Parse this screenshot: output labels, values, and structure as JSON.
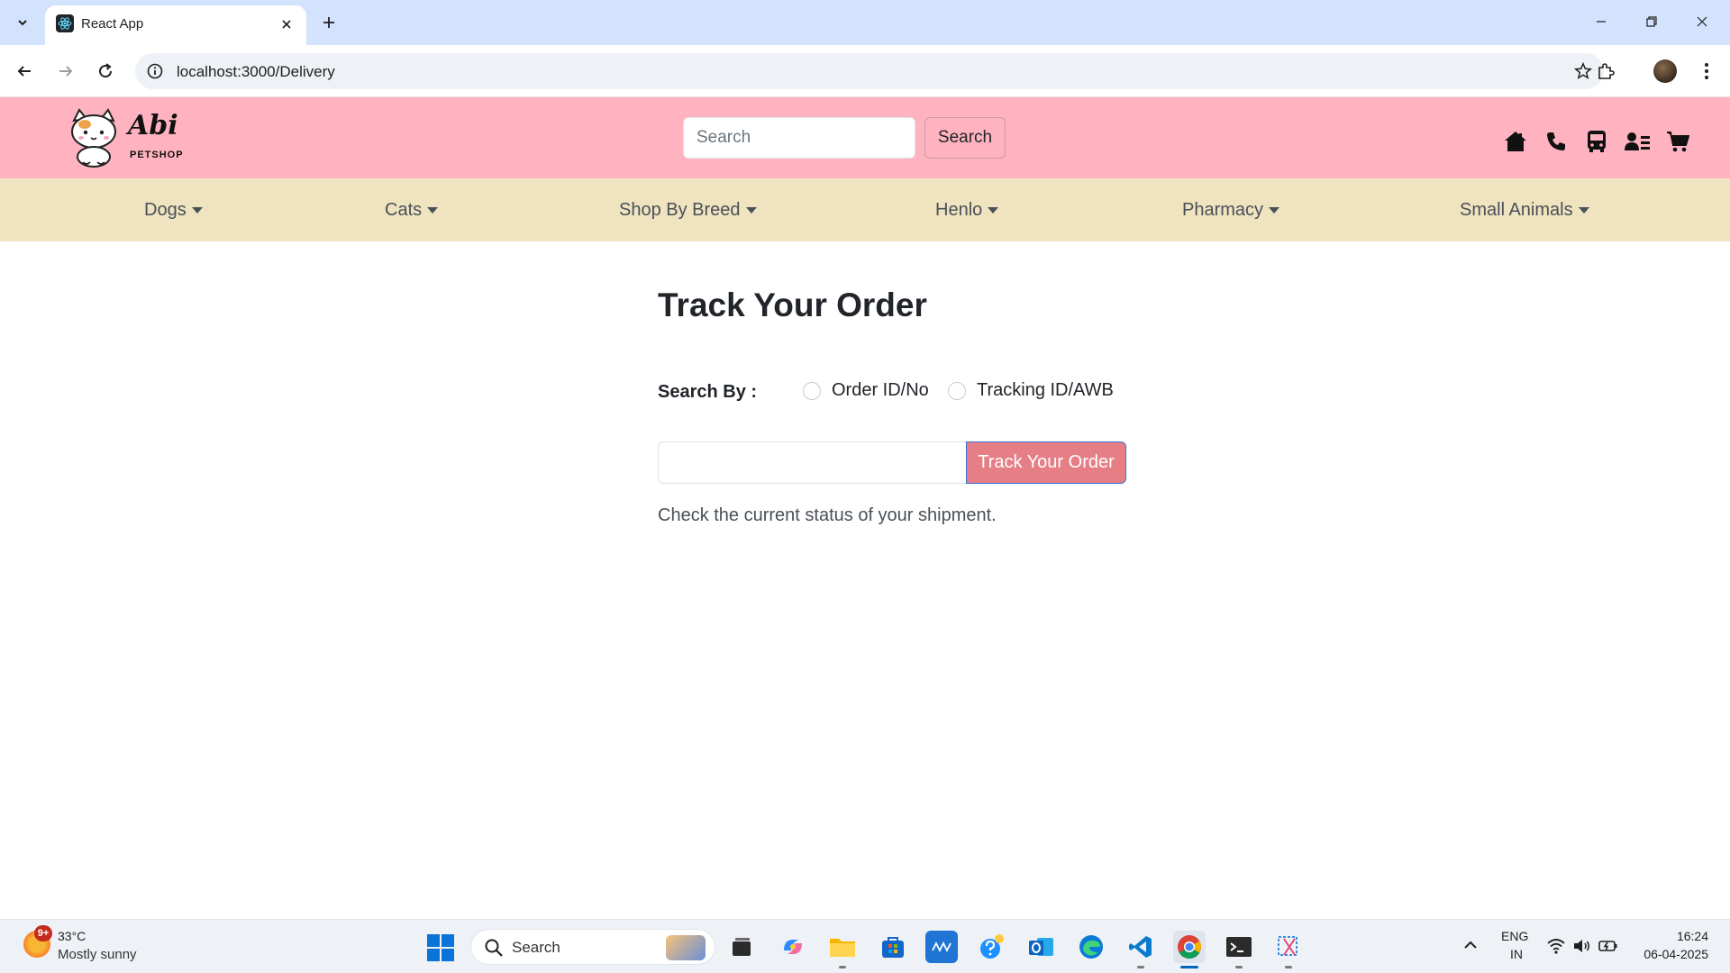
{
  "browser": {
    "tab_title": "React App",
    "url": "localhost:3000/Delivery"
  },
  "site": {
    "logo_script": "Abi",
    "logo_sub": "PETSHOP",
    "search": {
      "placeholder": "Search",
      "button_label": "Search"
    },
    "header_icons": [
      "home-icon",
      "phone-icon",
      "bus-icon",
      "user-list-icon",
      "cart-icon"
    ],
    "categories": [
      "Dogs",
      "Cats",
      "Shop By Breed",
      "Henlo",
      "Pharmacy",
      "Small Animals"
    ]
  },
  "main": {
    "title": "Track Your Order",
    "search_by_label": "Search By :",
    "options": [
      "Order ID/No",
      "Tracking ID/AWB"
    ],
    "button_label": "Track Your Order",
    "helper_text": "Check the current status of your shipment."
  },
  "colors": {
    "header_bg": "#ffb3c1",
    "nav_bg": "#efe3c0",
    "track_button": "#e67e86"
  },
  "taskbar": {
    "weather": {
      "badge": "9+",
      "temp": "33°C",
      "desc": "Mostly sunny"
    },
    "search_label": "Search",
    "lang_line1": "ENG",
    "lang_line2": "IN",
    "time": "16:24",
    "date": "06-04-2025"
  }
}
